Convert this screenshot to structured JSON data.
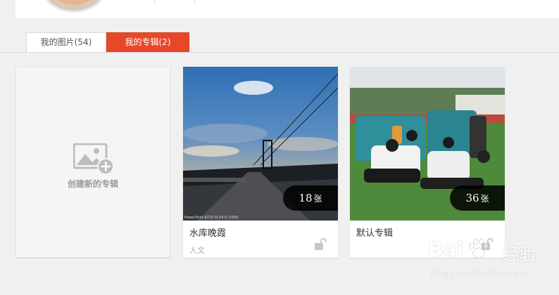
{
  "tabs": {
    "photos_label": "我的图片(54)",
    "albums_label": "我的专辑(2)"
  },
  "create_card": {
    "label": "创建新的专辑",
    "icon": "image-add-icon"
  },
  "albums": [
    {
      "title": "水库晚霞",
      "count": "18",
      "unit": "张",
      "tag": "人文",
      "photo_caption": "PowerShot A710 IS f/4.0 1/500",
      "lock_icon": "unlock-icon"
    },
    {
      "title": "默认专辑",
      "count": "36",
      "unit": "张",
      "tag": "",
      "lock_icon": "unlock-icon"
    }
  ],
  "watermark": {
    "brand_left": "Bai",
    "brand_right": "经验",
    "url": "jingyan.baidu.com"
  },
  "colors": {
    "accent": "#e8482a",
    "background": "#f0f0f0",
    "badge": "#000000"
  }
}
